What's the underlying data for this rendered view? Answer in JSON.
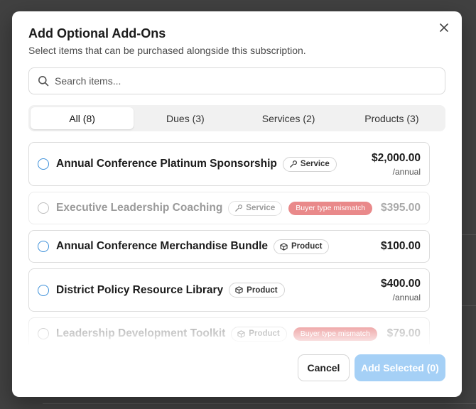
{
  "dialog": {
    "title": "Add Optional Add-Ons",
    "subtitle": "Select items that can be purchased alongside this subscription.",
    "close_icon": "close-icon"
  },
  "search": {
    "placeholder": "Search items...",
    "value": "",
    "icon": "search-icon"
  },
  "tabs": [
    {
      "label": "All (8)",
      "active": true
    },
    {
      "label": "Dues (3)",
      "active": false
    },
    {
      "label": "Services (2)",
      "active": false
    },
    {
      "label": "Products (3)",
      "active": false
    }
  ],
  "items": [
    {
      "name": "Annual Conference Platinum Sponsorship",
      "type": "Service",
      "type_icon": "wrench-icon",
      "price": "$2,000.00",
      "period": "/annual",
      "disabled": false,
      "warning": ""
    },
    {
      "name": "Executive Leadership Coaching",
      "type": "Service",
      "type_icon": "wrench-icon",
      "price": "$395.00",
      "period": "",
      "disabled": true,
      "warning": "Buyer type mismatch"
    },
    {
      "name": "Annual Conference Merchandise Bundle",
      "type": "Product",
      "type_icon": "box-icon",
      "price": "$100.00",
      "period": "",
      "disabled": false,
      "warning": ""
    },
    {
      "name": "District Policy Resource Library",
      "type": "Product",
      "type_icon": "box-icon",
      "price": "$400.00",
      "period": "/annual",
      "disabled": false,
      "warning": ""
    },
    {
      "name": "Leadership Development Toolkit",
      "type": "Product",
      "type_icon": "box-icon",
      "price": "$79.00",
      "period": "",
      "disabled": true,
      "warning": "Buyer type mismatch"
    }
  ],
  "footer": {
    "cancel_label": "Cancel",
    "add_label": "Add Selected (0)"
  },
  "colors": {
    "accent": "#3b8fd9",
    "primary_disabled": "#a5d0f6",
    "warning_badge": "#e9898a"
  }
}
